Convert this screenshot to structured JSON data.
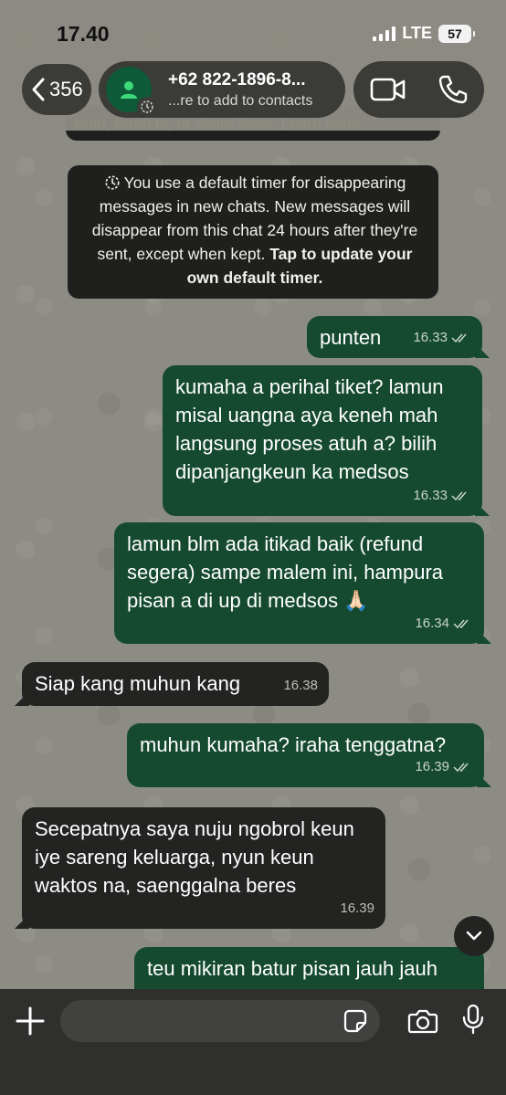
{
  "status_bar": {
    "time": "17.40",
    "network": "LTE",
    "battery": "57"
  },
  "header": {
    "back_count": "356",
    "contact_name": "+62 822-1896-8...",
    "contact_subtitle": "...re to add to contacts"
  },
  "peek_text": "read, listen to, or share them. Learn more",
  "system_message": {
    "text": "You use a default timer for disappearing messages in new chats. New messages will disappear from this chat 24 hours after they're sent, except when kept. ",
    "action": "Tap to update your own default timer."
  },
  "messages": [
    {
      "direction": "out",
      "text": "punten",
      "time": "16.33"
    },
    {
      "direction": "out",
      "text": "kumaha a perihal tiket? lamun misal uangna aya keneh mah langsung proses atuh a? bilih dipanjangkeun ka medsos",
      "time": "16.33"
    },
    {
      "direction": "out",
      "text": "lamun blm ada itikad baik (refund segera) sampe malem ini, hampura pisan a di up di medsos 🙏🏻",
      "time": "16.34"
    },
    {
      "direction": "in",
      "text": "Siap kang muhun kang",
      "time": "16.38"
    },
    {
      "direction": "out",
      "text": "muhun kumaha? iraha tenggatna?",
      "time": "16.39"
    },
    {
      "direction": "in",
      "text": "Secepatnya saya nuju ngobrol keun iye sareng keluarga, nyun keun waktos na, saenggalna beres",
      "time": "16.39"
    },
    {
      "direction": "out",
      "text": "teu mikiran batur pisan jauh jauh",
      "time": ""
    }
  ],
  "input": {
    "placeholder": ""
  },
  "colors": {
    "outgoing_bubble": "#154a31",
    "incoming_bubble": "#232322",
    "accent": "#0f5a38"
  }
}
